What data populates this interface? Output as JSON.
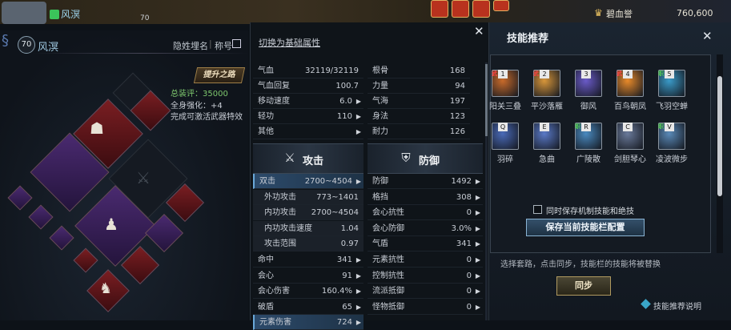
{
  "hud": {
    "player_name": "风溟",
    "level_small": "70",
    "currency_name": "碧血誉",
    "currency_amount": "760,600"
  },
  "character": {
    "level": "70",
    "name": "风溟",
    "hide_name": "隐姓埋名",
    "separator": "|",
    "title_btn": "称号",
    "upgrade_btn": "提升之路",
    "score": "总装评：35000",
    "strength": "全身强化：+4",
    "weapon_fx": "完成可激活武器特效"
  },
  "attributes": {
    "switch_tab": "切换为基础属性",
    "left_top": [
      {
        "label": "气血",
        "value": "32119/32119",
        "arrow": false
      },
      {
        "label": "气血回复",
        "value": "100.7",
        "arrow": false
      },
      {
        "label": "移动速度",
        "value": "6.0",
        "arrow": true
      },
      {
        "label": "轻功",
        "value": "110",
        "arrow": true
      },
      {
        "label": "其他",
        "value": "",
        "arrow": true
      }
    ],
    "right_top": [
      {
        "label": "根骨",
        "value": "168"
      },
      {
        "label": "力量",
        "value": "94"
      },
      {
        "label": "气海",
        "value": "197"
      },
      {
        "label": "身法",
        "value": "123"
      },
      {
        "label": "耐力",
        "value": "126"
      }
    ],
    "attack_title": "攻击",
    "defense_title": "防御",
    "attack_rows": [
      {
        "label": "双击",
        "value": "2700~4504",
        "arrow": true,
        "hl": true,
        "sub": false
      },
      {
        "label": "外功攻击",
        "value": "773~1401",
        "arrow": false,
        "hl": false,
        "sub": true
      },
      {
        "label": "内功攻击",
        "value": "2700~4504",
        "arrow": false,
        "hl": false,
        "sub": true
      },
      {
        "label": "内功攻击速度",
        "value": "1.04",
        "arrow": false,
        "hl": false,
        "sub": true
      },
      {
        "label": "攻击范围",
        "value": "0.97",
        "arrow": false,
        "hl": false,
        "sub": true
      },
      {
        "label": "命中",
        "value": "341",
        "arrow": true,
        "hl": false,
        "sub": false
      },
      {
        "label": "会心",
        "value": "91",
        "arrow": true,
        "hl": false,
        "sub": false
      },
      {
        "label": "会心伤害",
        "value": "160.4%",
        "arrow": true,
        "hl": false,
        "sub": false
      },
      {
        "label": "破盾",
        "value": "65",
        "arrow": true,
        "hl": false,
        "sub": false
      },
      {
        "label": "元素伤害",
        "value": "724",
        "arrow": true,
        "hl": true,
        "sub": false
      }
    ],
    "defense_rows": [
      {
        "label": "防御",
        "value": "1492",
        "arrow": true
      },
      {
        "label": "格挡",
        "value": "308",
        "arrow": true
      },
      {
        "label": "会心抗性",
        "value": "0",
        "arrow": true
      },
      {
        "label": "会心防御",
        "value": "3.0%",
        "arrow": true
      },
      {
        "label": "气盾",
        "value": "341",
        "arrow": true
      },
      {
        "label": "元素抗性",
        "value": "0",
        "arrow": true
      },
      {
        "label": "控制抗性",
        "value": "0",
        "arrow": true
      },
      {
        "label": "流派抵御",
        "value": "0",
        "arrow": true
      },
      {
        "label": "怪物抵御",
        "value": "0",
        "arrow": true
      }
    ]
  },
  "skills": {
    "title": "技能推荐",
    "row1": [
      {
        "key": "1",
        "name": "阳关三叠",
        "tag": "武",
        "color": "#c86a2a"
      },
      {
        "key": "2",
        "name": "平沙落雁",
        "tag": "武",
        "color": "#d8963a"
      },
      {
        "key": "3",
        "name": "御风",
        "tag": "",
        "color": "#6a5ac8"
      },
      {
        "key": "4",
        "name": "百鸟朝凤",
        "tag": "武",
        "color": "#e88a2a"
      },
      {
        "key": "5",
        "name": "飞羽空蝉",
        "tag": "职",
        "color": "#3a9ac8"
      }
    ],
    "row2": [
      {
        "key": "Q",
        "name": "羽碎",
        "tag": "",
        "color": "#4a6ab8"
      },
      {
        "key": "E",
        "name": "急曲",
        "tag": "",
        "color": "#5a7ac8"
      },
      {
        "key": "R",
        "name": "广陵散",
        "tag": "职",
        "color": "#4a8ac0"
      },
      {
        "key": "C",
        "name": "剑胆琴心",
        "tag": "",
        "color": "#6a7a9a"
      },
      {
        "key": "V",
        "name": "凌波微步",
        "tag": "职",
        "color": "#5a8ab8"
      }
    ],
    "checkbox_label": "同时保存机制技能和绝技",
    "save_btn": "保存当前技能栏配置",
    "hint": "选择套路，点击同步，技能栏的技能将被替换",
    "sync_btn": "同步",
    "help": "技能推荐说明"
  }
}
